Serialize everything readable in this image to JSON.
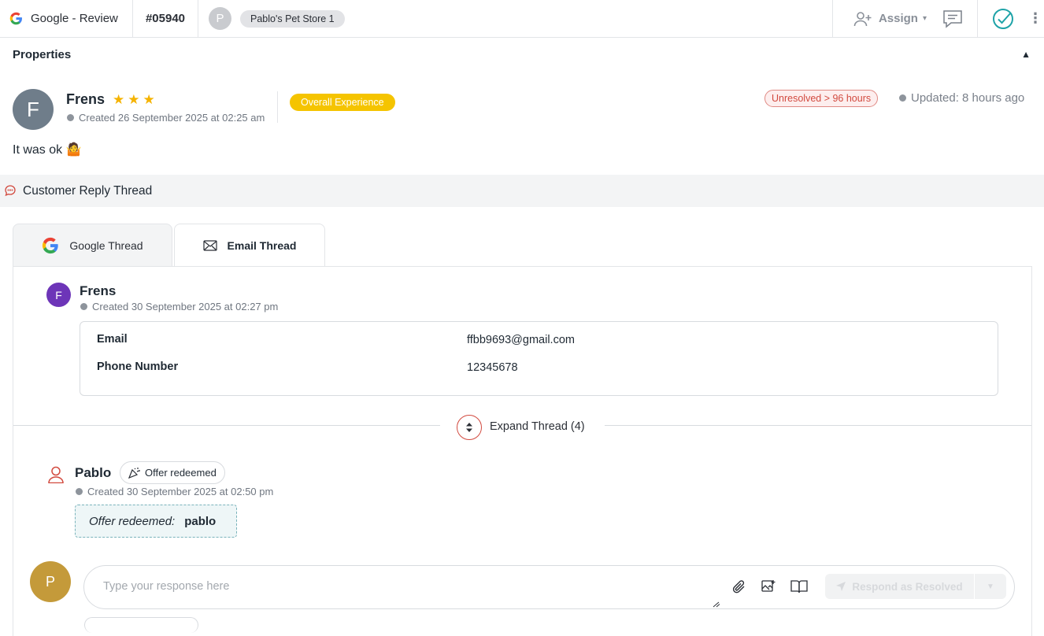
{
  "topbar": {
    "source_label": "Google - Review",
    "ticket_id": "#05940",
    "store_avatar_letter": "P",
    "store_name": "Pablo's Pet Store 1",
    "assign_label": "Assign"
  },
  "properties": {
    "title": "Properties"
  },
  "review": {
    "avatar_letter": "F",
    "author": "Frens",
    "rating": 3,
    "stars": "★★★",
    "created": "Created 26 September 2025 at 02:25 am",
    "category_badge": "Overall Experience",
    "status_badge": "Unresolved > 96 hours",
    "updated": "Updated: 8 hours ago",
    "text": "It was ok 🤷"
  },
  "thread": {
    "header": "Customer Reply Thread",
    "tabs": [
      {
        "label": "Google Thread",
        "active": false
      },
      {
        "label": "Email Thread",
        "active": true
      }
    ]
  },
  "email_message": {
    "avatar_letter": "F",
    "author": "Frens",
    "created": "Created 30 September 2025 at 02:27 pm",
    "fields": [
      {
        "label": "Email",
        "value": "ffbb9693@gmail.com"
      },
      {
        "label": "Phone Number",
        "value": "12345678"
      }
    ]
  },
  "expand": {
    "label": "Expand Thread (4)"
  },
  "pablo_message": {
    "author": "Pablo",
    "badge": "Offer redeemed",
    "created": "Created 30 September 2025 at 02:50 pm",
    "offer_label": "Offer redeemed:",
    "offer_value": "pablo"
  },
  "reply": {
    "avatar_letter": "P",
    "placeholder": "Type your response here",
    "respond_label": "Respond as Resolved"
  },
  "colors": {
    "accent_red": "#d24a3f",
    "overall_yellow": "#f5c400",
    "star_yellow": "#f5b301",
    "check_teal": "#1fa3a8",
    "purple_avatar": "#6d35b8",
    "gold_avatar": "#c49a3a"
  }
}
